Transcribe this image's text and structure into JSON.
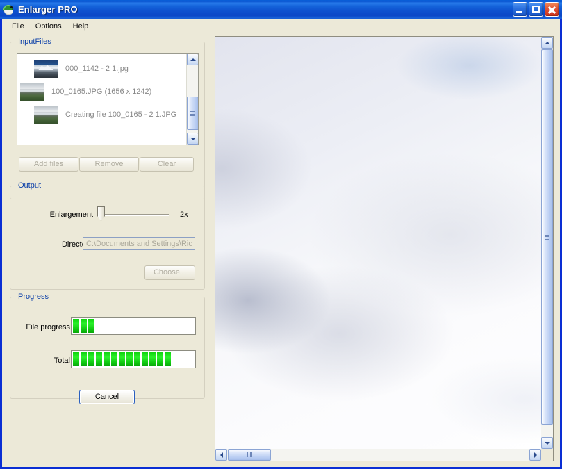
{
  "window": {
    "title": "Enlarger PRO",
    "icon": "turtle-icon",
    "buttons": {
      "minimize": "minimize-icon",
      "maximize": "maximize-icon",
      "close": "close-icon"
    }
  },
  "menubar": {
    "items": [
      {
        "label": "File"
      },
      {
        "label": "Options"
      },
      {
        "label": "Help"
      }
    ]
  },
  "input_files": {
    "group_title": "InputFiles",
    "rows": [
      {
        "label": "000_1142 - 2 1.jpg",
        "level": "child",
        "thumb": "photo-mountain-thumb"
      },
      {
        "label": "100_0165.JPG (1656 x 1242)",
        "level": "root",
        "thumb": "photo-landscape-thumb"
      },
      {
        "label": "Creating file 100_0165 - 2 1.JPG",
        "level": "child",
        "thumb": "photo-landscape-thumb"
      }
    ],
    "buttons": [
      {
        "label": "Add files",
        "enabled": false
      },
      {
        "label": "Remove",
        "enabled": false
      },
      {
        "label": "Clear",
        "enabled": false
      }
    ]
  },
  "output": {
    "group_title": "Output",
    "enlargement_label": "Enlargement",
    "enlargement_value": "2x",
    "directory_label": "Directory",
    "directory_value": "C:\\Documents and Settings\\Ric",
    "choose_label": "Choose..."
  },
  "progress": {
    "group_title": "Progress",
    "file_label": "File progress",
    "file_blocks": 3,
    "total_label": "Total",
    "total_blocks": 13
  },
  "actions": {
    "cancel_label": "Cancel"
  },
  "colors": {
    "titlebar_blue": "#0b51cf",
    "group_title_blue": "#0b3fa8",
    "progress_green": "#19d119",
    "face": "#ece9d8"
  }
}
